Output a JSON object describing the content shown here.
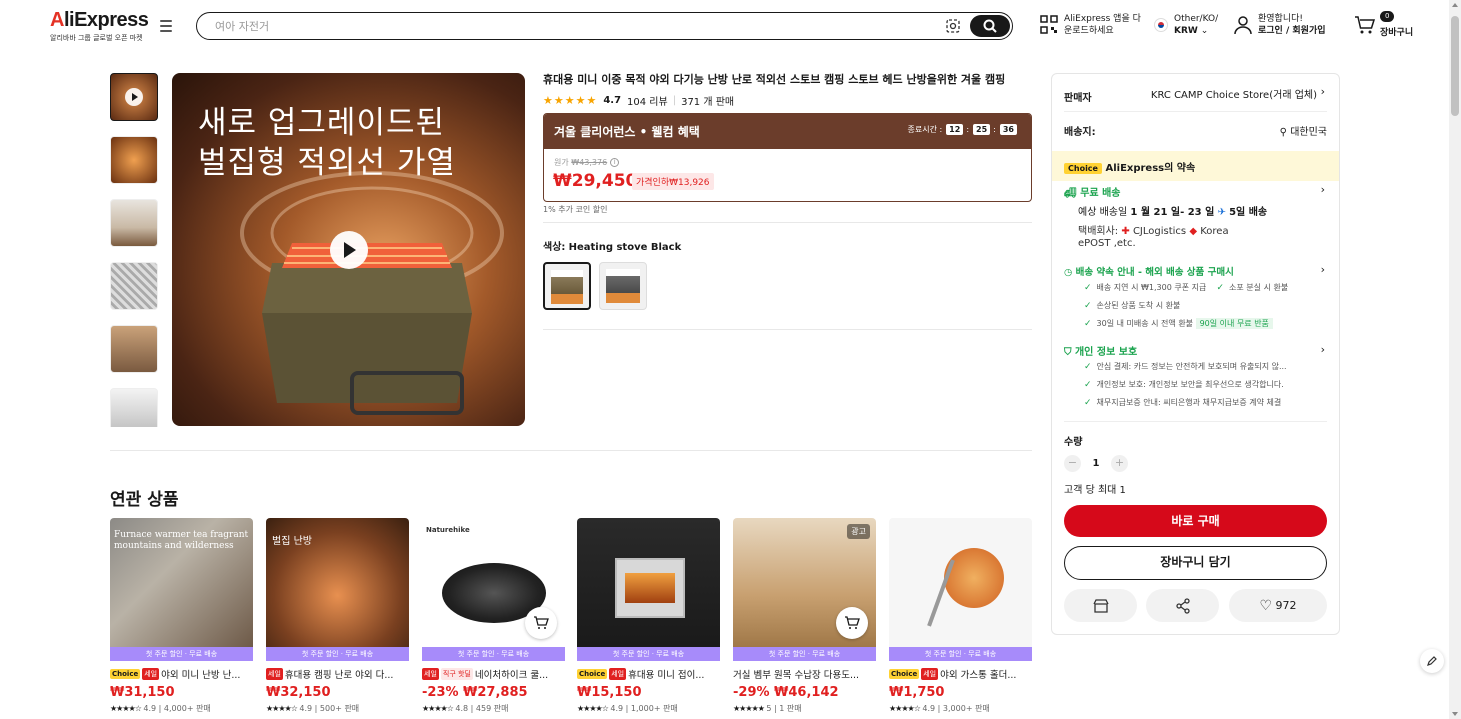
{
  "header": {
    "logo_text": "AliExpress",
    "logo_sub": "알리바바 그룹 글로벌 오픈 마켓",
    "search_placeholder": "여아 자전거",
    "app_download": "AliExpress 앱을 다운로드하세요",
    "lang_region": "Other/KO/",
    "currency": "KRW",
    "welcome": "환영합니다!",
    "login": "로그인 / 회원가입",
    "cart_count": "0",
    "cart_label": "장바구니"
  },
  "product": {
    "main_image_text_line1": "새로 업그레이드된",
    "main_image_text_line2": "벌집형 적외선 가열",
    "title": "휴대용 미니 이중 목적 야외 다기능 난방 난로 적외선 스토브 캠핑 스토브 헤드 난방을위한 겨울 캠핑",
    "rating": "4.7",
    "stars": "★★★★★",
    "reviews": "104 리뷰",
    "sold": "371 개 판매",
    "deal_label": "겨울 클리어런스 • 웰컴 혜택",
    "deal_ends": "종료시간 :",
    "timer": [
      "12",
      "25",
      "36"
    ],
    "orig_label": "원가",
    "orig_price": "₩43,376",
    "price": "₩29,450",
    "discount": "가격인하₩13,926",
    "coin": "1% 추가 코인 할인",
    "color_label": "색상:",
    "color_value": "Heating stove Black"
  },
  "seller_panel": {
    "seller_label": "판매자",
    "seller_name": "KRC CAMP Choice Store(거래 업체)",
    "ship_to_label": "배송지:",
    "ship_to": "대한민국",
    "choice_badge": "Choice",
    "choice_promise": "AliExpress의 약속",
    "free_shipping": "무료 배송",
    "delivery_pre": "예상 배송일",
    "delivery_dates": "1 월 21 일- 23 일",
    "delivery_days": "5일 배송",
    "carrier_label": "택배회사:",
    "carrier1": "CJLogistics",
    "carrier2": "Korea",
    "carrier3": "ePOST ,etc.",
    "guarantee_title": "배송 약속 안내 - 해외 배송 상품 구매시",
    "guarantee_items": [
      "배송 지연 시 ₩1,300 쿠폰 지급",
      "소포 분실 시 환불",
      "손상된 상품 도착 시 환불",
      "30일 내 미배송 시 전액 환불"
    ],
    "guarantee_badge": "90일 이내 무료 반품",
    "privacy_title": "개인 정보 보호",
    "privacy_items": [
      "안심 결제: 카드 정보는 안전하게 보호되며 유출되지 않...",
      "개인정보 보호: 개인정보 보안을 최우선으로 생각합니다.",
      "채무지급보증 안내: 씨티은행과 채무지급보증 계약 체결"
    ],
    "qty_label": "수량",
    "qty_value": "1",
    "qty_limit": "고객 당 최대 1",
    "buy_now": "바로 구매",
    "add_cart": "장바구니 담기",
    "wish_count": "972"
  },
  "related": {
    "title": "연관 상품",
    "promo_strip": "첫 주문 할인 · 무료 배송",
    "items": [
      {
        "choice": "Choice",
        "sale": "세일",
        "name": "야외 미니 난방 난...",
        "price": "₩31,150",
        "pct": "",
        "stars": "★★★★☆",
        "rating": "4.9",
        "sold": "4,000+ 판매",
        "img_text": "Furnace warmer tea fragrant mountains and wilderness"
      },
      {
        "choice": "",
        "sale": "세일",
        "name": "휴대용 캠핑 난로 야외 다...",
        "price": "₩32,150",
        "pct": "",
        "stars": "★★★★☆",
        "rating": "4.9",
        "sold": "500+ 판매",
        "img_text": "벌집 난방"
      },
      {
        "choice": "",
        "sale": "세일",
        "name": "네이처하이크 쿨...",
        "price": "₩27,885",
        "pct": "-23%",
        "stars": "★★★★☆",
        "rating": "4.8",
        "sold": "459 판매",
        "img_text": "Naturehike",
        "extra_tag": "직구 핫딜"
      },
      {
        "choice": "Choice",
        "sale": "세일",
        "name": "휴대용 미니 접이...",
        "price": "₩15,150",
        "pct": "",
        "stars": "★★★★☆",
        "rating": "4.9",
        "sold": "1,000+ 판매",
        "img_text": ""
      },
      {
        "choice": "",
        "sale": "",
        "name": "거실 벰부 원목 수납장 다용도...",
        "price": "₩46,142",
        "pct": "-29%",
        "stars": "★★★★★",
        "rating": "5",
        "sold": "1 판매",
        "img_text": "",
        "ad": "광고"
      },
      {
        "choice": "Choice",
        "sale": "세일",
        "name": "야외 가스통 홀더...",
        "price": "₩1,750",
        "pct": "",
        "stars": "★★★★☆",
        "rating": "4.9",
        "sold": "3,000+ 판매",
        "img_text": ""
      }
    ]
  },
  "colors": {
    "accent_red": "#e02020",
    "buy_red": "#d6091a",
    "deal_brown": "#6b3d2b",
    "green": "#1ba34e",
    "choice_yellow": "#ffd233",
    "promo_purple": "#a78bfa"
  }
}
